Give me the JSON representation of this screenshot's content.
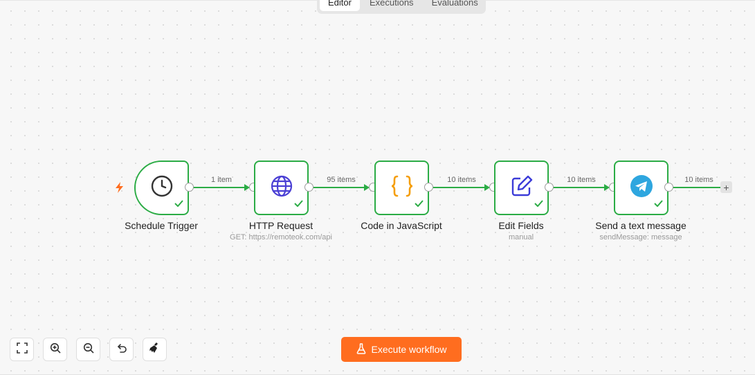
{
  "tabs": [
    {
      "label": "Editor",
      "active": true
    },
    {
      "label": "Executions",
      "active": false
    },
    {
      "label": "Evaluations",
      "active": false
    }
  ],
  "nodes": [
    {
      "title": "Schedule Trigger",
      "subtitle": "",
      "icon": "clock-icon",
      "status": "success"
    },
    {
      "title": "HTTP Request",
      "subtitle": "GET: https://remoteok.com/api",
      "icon": "globe-icon",
      "status": "success"
    },
    {
      "title": "Code in JavaScript",
      "subtitle": "",
      "icon": "code-braces-icon",
      "status": "success"
    },
    {
      "title": "Edit Fields",
      "subtitle": "manual",
      "icon": "pencil-square-icon",
      "status": "success"
    },
    {
      "title": "Send a text message",
      "subtitle": "sendMessage: message",
      "icon": "telegram-icon",
      "status": "success"
    }
  ],
  "connections": [
    {
      "label": "1 item"
    },
    {
      "label": "95 items"
    },
    {
      "label": "10 items"
    },
    {
      "label": "10 items"
    },
    {
      "label": "10 items"
    }
  ],
  "add_node_symbol": "+",
  "controls": [
    "fit-view-icon",
    "zoom-in-icon",
    "zoom-out-icon",
    "reset-zoom-icon",
    "tidy-up-icon"
  ],
  "execute_button": {
    "label": "Execute workflow",
    "icon": "flask-icon"
  },
  "colors": {
    "success": "#2bac45",
    "accent": "#ff6d1f",
    "code": "#f59e0b",
    "http": "#4a3fd4",
    "edit": "#3b3bd8",
    "telegram": "#2ea6df"
  }
}
